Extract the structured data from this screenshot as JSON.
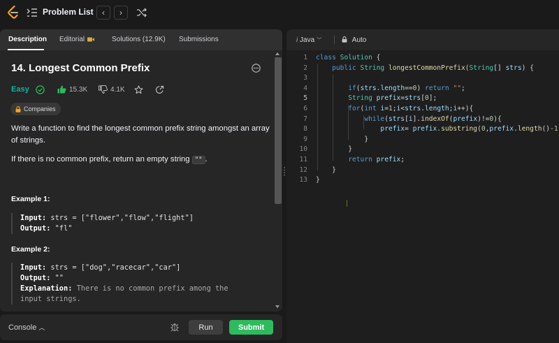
{
  "topbar": {
    "title": "Problem List",
    "prev_glyph": "‹",
    "next_glyph": "›"
  },
  "tabs": [
    {
      "label": "Description"
    },
    {
      "label": "Editorial"
    },
    {
      "label": "Solutions (12.9K)"
    },
    {
      "label": "Submissions"
    }
  ],
  "problem": {
    "title": "14. Longest Common Prefix",
    "difficulty": "Easy",
    "likes": "15.3K",
    "dislikes": "4.1K",
    "companies_label": "Companies",
    "para1": "Write a function to find the longest common prefix string amongst an array of strings.",
    "para2_before": "If there is no common prefix, return an empty string ",
    "para2_code": "\"\"",
    "para2_after": ".",
    "example1": {
      "title": "Example 1:",
      "input_label": "Input:",
      "input": "strs = [\"flower\",\"flow\",\"flight\"]",
      "output_label": "Output:",
      "output": "\"fl\""
    },
    "example2": {
      "title": "Example 2:",
      "input_label": "Input:",
      "input": "strs = [\"dog\",\"racecar\",\"car\"]",
      "output_label": "Output:",
      "output": "\"\"",
      "explanation_label": "Explanation:",
      "explanation_line1": "There is no common prefix among the",
      "explanation_line2": "input strings."
    }
  },
  "console": {
    "label": "Console",
    "run_label": "Run",
    "submit_label": "Submit"
  },
  "editor": {
    "language": "Java",
    "mode": "Auto",
    "line_numbers": [
      "1",
      "2",
      "3",
      "4",
      "5",
      "6",
      "7",
      "8",
      "9",
      "10",
      "11",
      "12",
      "13"
    ]
  },
  "colors": {
    "accent_green": "#2cbb5d",
    "easy": "#00b8a3",
    "like_green": "#2cbb5d"
  }
}
